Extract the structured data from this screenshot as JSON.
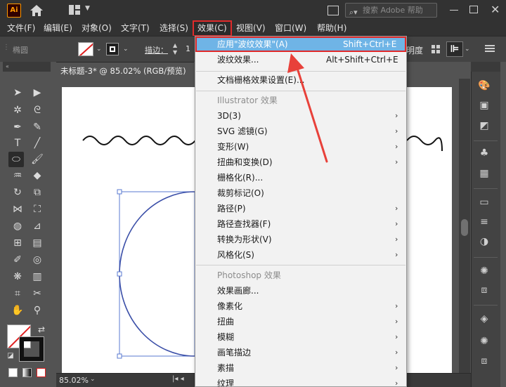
{
  "app": {
    "logo_text": "Ai",
    "search_placeholder": "搜索 Adobe 帮助",
    "close_glyph": "✕"
  },
  "menubar": {
    "items": [
      "文件(F)",
      "编辑(E)",
      "对象(O)",
      "文字(T)",
      "选择(S)",
      "效果(C)",
      "视图(V)",
      "窗口(W)",
      "帮助(H)"
    ],
    "active_index": 5,
    "highlight_color": "#e02a2a"
  },
  "controlbar": {
    "object_label": "椭圆",
    "stroke_label": "描边：",
    "stroke_value": "1",
    "opacity_label": "明度"
  },
  "document": {
    "tab_title": "未标题-3* @ 85.02% (RGB/预览)",
    "zoom": "85.02%"
  },
  "effect_menu": {
    "apply_item": {
      "label": "应用\"波纹效果\"(A)",
      "shortcut": "Shift+Ctrl+E"
    },
    "last_item": {
      "label": "波纹效果...",
      "shortcut": "Alt+Shift+Ctrl+E"
    },
    "doc_raster": "文档栅格效果设置(E)...",
    "illustrator_section": "Illustrator 效果",
    "illustrator_items": [
      {
        "label": "3D(3)",
        "submenu": true
      },
      {
        "label": "SVG 滤镜(G)",
        "submenu": true
      },
      {
        "label": "变形(W)",
        "submenu": true
      },
      {
        "label": "扭曲和变换(D)",
        "submenu": true
      },
      {
        "label": "栅格化(R)...",
        "submenu": false
      },
      {
        "label": "裁剪标记(O)",
        "submenu": false
      },
      {
        "label": "路径(P)",
        "submenu": true
      },
      {
        "label": "路径查找器(F)",
        "submenu": true
      },
      {
        "label": "转换为形状(V)",
        "submenu": true
      },
      {
        "label": "风格化(S)",
        "submenu": true
      }
    ],
    "photoshop_section": "Photoshop 效果",
    "photoshop_items": [
      {
        "label": "效果画廊...",
        "submenu": false
      },
      {
        "label": "像素化",
        "submenu": true
      },
      {
        "label": "扭曲",
        "submenu": true
      },
      {
        "label": "模糊",
        "submenu": true
      },
      {
        "label": "画笔描边",
        "submenu": true
      },
      {
        "label": "素描",
        "submenu": true
      },
      {
        "label": "纹理",
        "submenu": true
      }
    ],
    "highlight_bg": "#6fb4e6"
  },
  "colors": {
    "annotation_red": "#e8413a",
    "circle_stroke": "#3b4fa8",
    "selection_blue": "#5a7ad0"
  }
}
